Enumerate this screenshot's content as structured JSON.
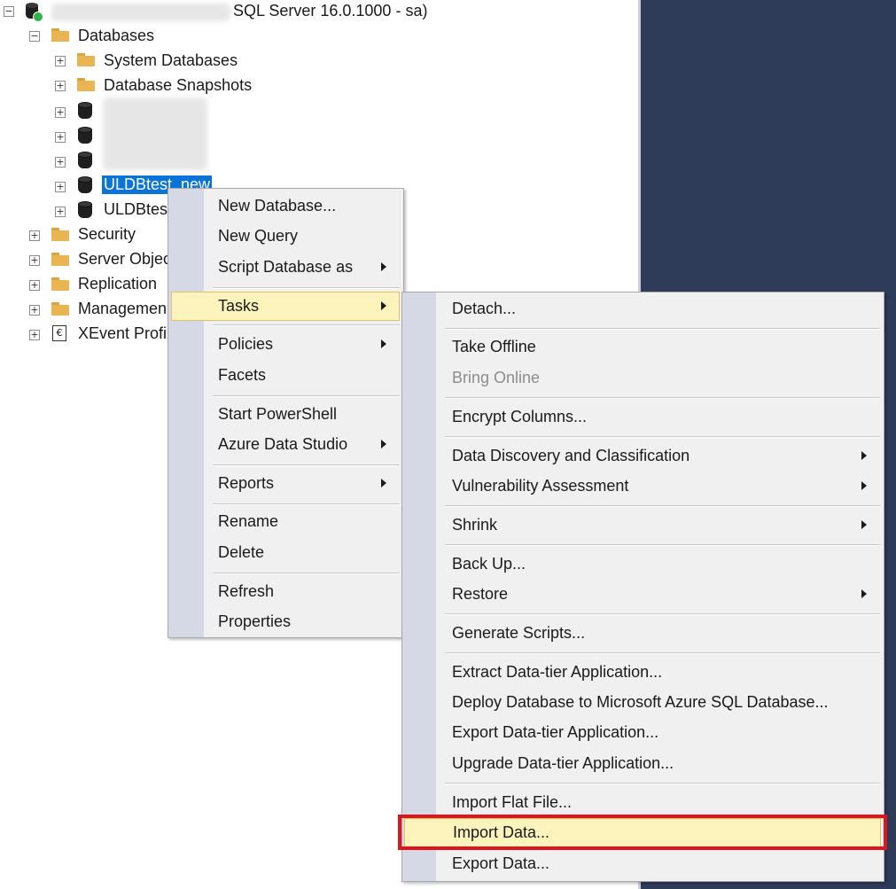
{
  "tree": {
    "server_label": "SQL Server 16.0.1000 - sa)",
    "databases": "Databases",
    "system_databases": "System Databases",
    "database_snapshots": "Database Snapshots",
    "selected_db": "ULDBtest_new",
    "db2": "ULDBtest",
    "security": "Security",
    "server_objects": "Server Objec",
    "replication": "Replication",
    "management": "Managemen",
    "xevent": "XEvent Profi"
  },
  "context_menu": {
    "new_database": "New Database...",
    "new_query": "New Query",
    "script_database_as": "Script Database as",
    "tasks": "Tasks",
    "policies": "Policies",
    "facets": "Facets",
    "start_powershell": "Start PowerShell",
    "azure_data_studio": "Azure Data Studio",
    "reports": "Reports",
    "rename": "Rename",
    "delete": "Delete",
    "refresh": "Refresh",
    "properties": "Properties"
  },
  "tasks_menu": {
    "detach": "Detach...",
    "take_offline": "Take Offline",
    "bring_online": "Bring Online",
    "encrypt_columns": "Encrypt Columns...",
    "data_discovery": "Data Discovery and Classification",
    "vulnerability": "Vulnerability Assessment",
    "shrink": "Shrink",
    "back_up": "Back Up...",
    "restore": "Restore",
    "generate_scripts": "Generate Scripts...",
    "extract_dac": "Extract Data-tier Application...",
    "deploy_azure": "Deploy Database to Microsoft Azure SQL Database...",
    "export_dac": "Export Data-tier Application...",
    "upgrade_dac": "Upgrade Data-tier Application...",
    "import_flat_file": "Import Flat File...",
    "import_data": "Import Data...",
    "export_data": "Export Data..."
  },
  "colors": {
    "highlight": "#fdf3bd",
    "selection": "#0a74d6",
    "annotation_red": "#e0141e",
    "background_right": "#2e3c5a"
  }
}
